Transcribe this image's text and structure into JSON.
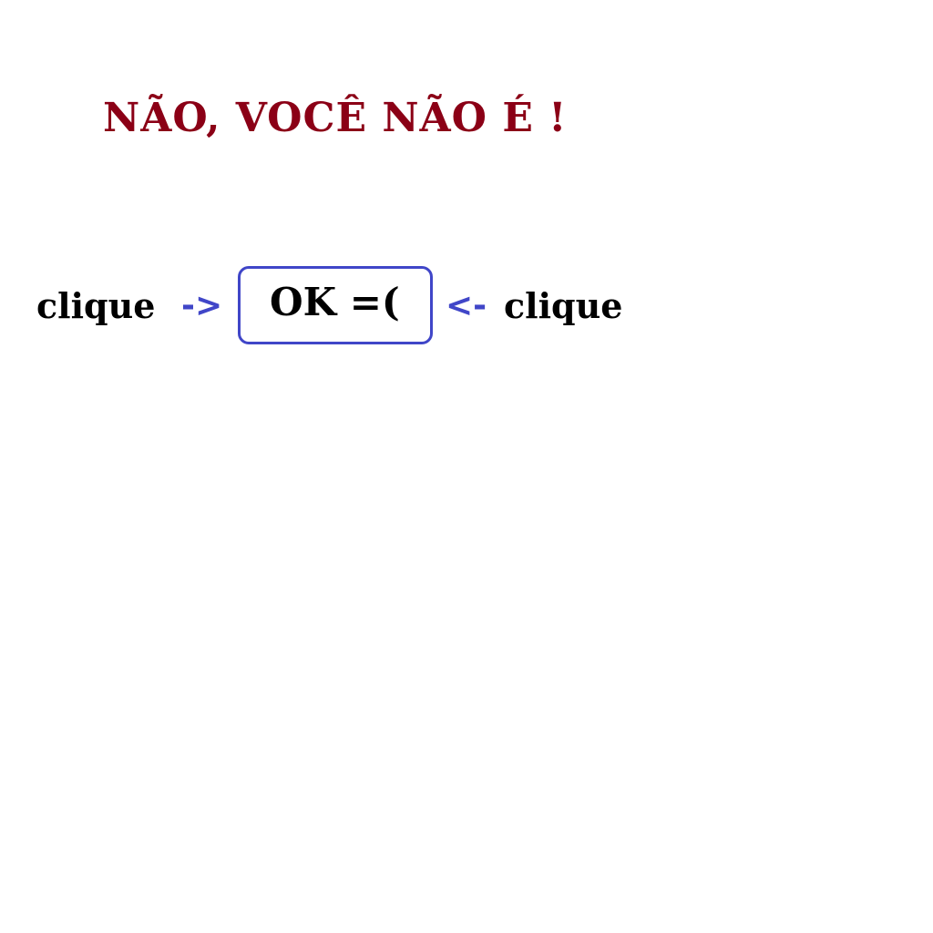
{
  "heading": {
    "text": "NÃO, VOCÊ NÃO É !",
    "color": "#8b0016"
  },
  "prompt": {
    "left_label": "clique",
    "left_arrow": "->",
    "right_arrow": "<-",
    "right_label": "clique",
    "arrow_color": "#4046c8"
  },
  "ok_button": {
    "label": "OK =(",
    "border_color": "#4046c8"
  }
}
